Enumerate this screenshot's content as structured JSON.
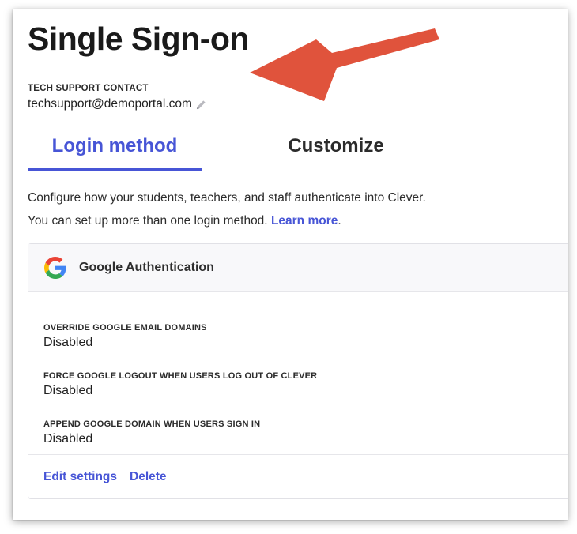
{
  "page": {
    "title": "Single Sign-on"
  },
  "tech_support": {
    "label": "TECH SUPPORT CONTACT",
    "email": "techsupport@demoportal.com",
    "edit_icon": "pencil-icon"
  },
  "tabs": [
    {
      "label": "Login method",
      "active": true
    },
    {
      "label": "Customize",
      "active": false
    }
  ],
  "description": {
    "line1": "Configure how your students, teachers, and staff authenticate into Clever.",
    "line2": "You can set up more than one login method.",
    "link": "Learn more",
    "after_link": "."
  },
  "auth_card": {
    "icon": "google-g-icon",
    "title": "Google Authentication",
    "settings": [
      {
        "label": "OVERRIDE GOOGLE EMAIL DOMAINS",
        "value": "Disabled"
      },
      {
        "label": "FORCE GOOGLE LOGOUT WHEN USERS LOG OUT OF CLEVER",
        "value": "Disabled"
      },
      {
        "label": "APPEND GOOGLE DOMAIN WHEN USERS SIGN IN",
        "value": "Disabled"
      }
    ],
    "actions": {
      "edit": "Edit settings",
      "delete": "Delete"
    }
  },
  "colors": {
    "accent": "#4755d6",
    "annotation_arrow": "#e0533c"
  }
}
